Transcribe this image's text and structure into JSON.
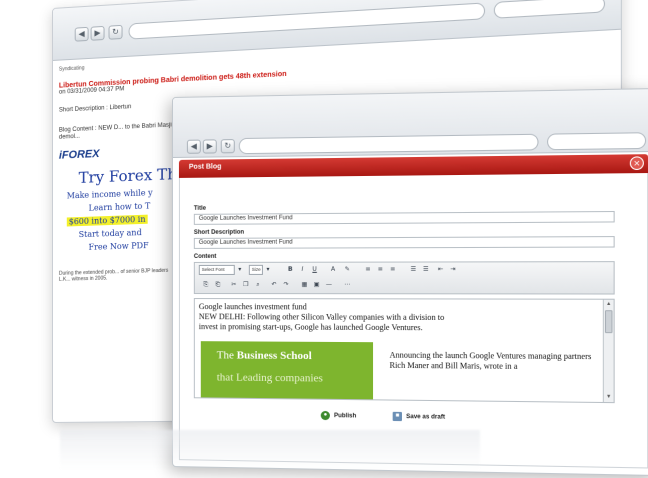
{
  "back_window": {
    "syndicating": "Syndicating",
    "headline": "Libertun Commission probing Babri demolition gets 48th extension",
    "on_date": "on 03/31/2009 04:37 PM",
    "short_description": "Short Description : Libertun",
    "blog_content": "Blog Content : NEW D... to the Babri Masjid demol...",
    "ad": {
      "brand": "iFOREX",
      "title": "Try Forex Th",
      "lines": [
        "Make income while y",
        "Learn how to T",
        "$600 into $7000 in",
        "Start today and",
        "Free Now PDF"
      ]
    },
    "footer": "During the extended prob... of senior BJP leaders L.K... witness in 2005."
  },
  "front_window": {
    "panel_title": "Post Blog",
    "close_icon_label": "×",
    "fields": {
      "title_label": "Title",
      "title_value": "Google Launches Investment Fund",
      "short_desc_label": "Short Description",
      "short_desc_value": "Google Launches Investment Fund",
      "content_label": "Content"
    },
    "toolbar": {
      "font_select": "Select Font",
      "size_select": "Size",
      "bold": "B",
      "italic": "I",
      "underline": "U"
    },
    "editor": {
      "line1": "Google launches investment fund",
      "line2": "NEW DELHI: Following other Silicon Valley companies with a division to",
      "line3": "invest in promising start-ups, Google has launched Google Ventures.",
      "green_l1_pre": "The ",
      "green_l1_bold": "Business School",
      "green_l2": "that Leading companies",
      "right_text": "Announcing the launch Google Ventures managing partners Rich Maner and Bill Maris, wrote in a"
    },
    "actions": {
      "publish": "Publish",
      "save_draft": "Save as draft"
    }
  },
  "colors": {
    "panel_header": "#b8211b",
    "green_block": "#7eb52e",
    "headline_red": "#cc1a14"
  }
}
